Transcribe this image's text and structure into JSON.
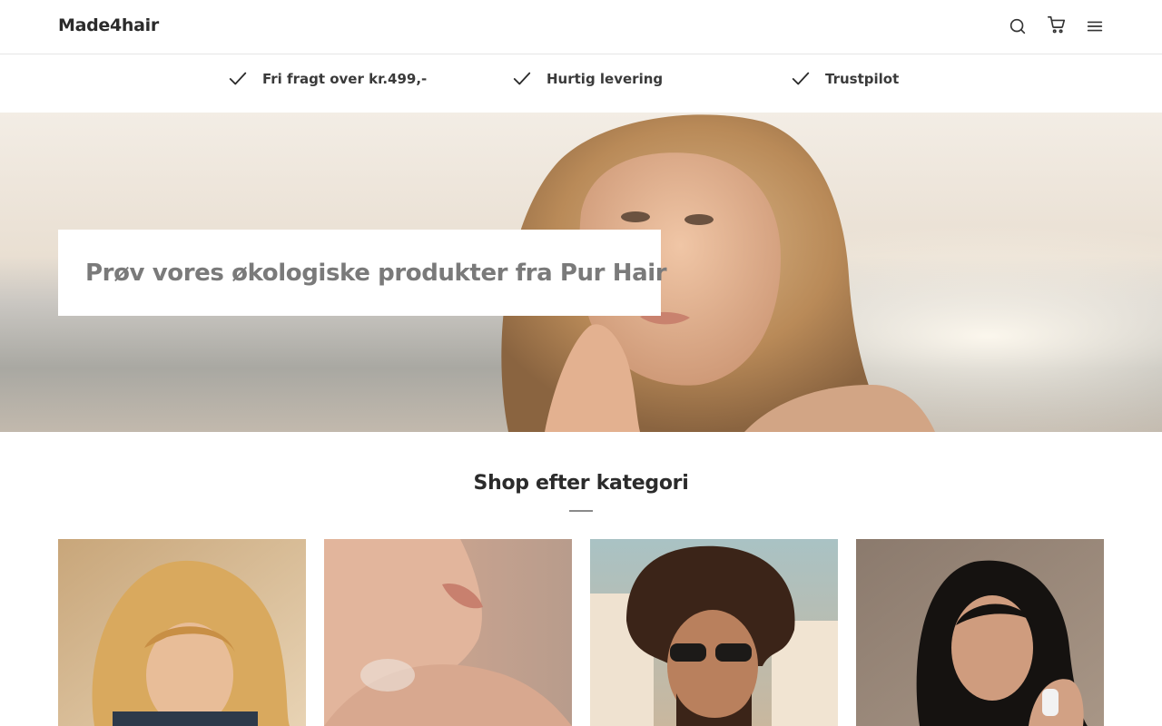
{
  "header": {
    "logo": "Made4hair",
    "icons": [
      "search-icon",
      "cart-icon",
      "menu-icon"
    ]
  },
  "usp": [
    {
      "icon": "check-icon",
      "label": "Fri fragt over kr.499,-"
    },
    {
      "icon": "check-icon",
      "label": "Hurtig levering"
    },
    {
      "icon": "check-icon",
      "label": "Trustpilot"
    }
  ],
  "hero": {
    "title": "Prøv vores økologiske produkter fra Pur Hair"
  },
  "categories": {
    "title": "Shop efter kategori"
  },
  "colors": {
    "text": "#2b2b2b",
    "hero_title": "#7a7a7a",
    "divider": "#e6e6e6"
  }
}
